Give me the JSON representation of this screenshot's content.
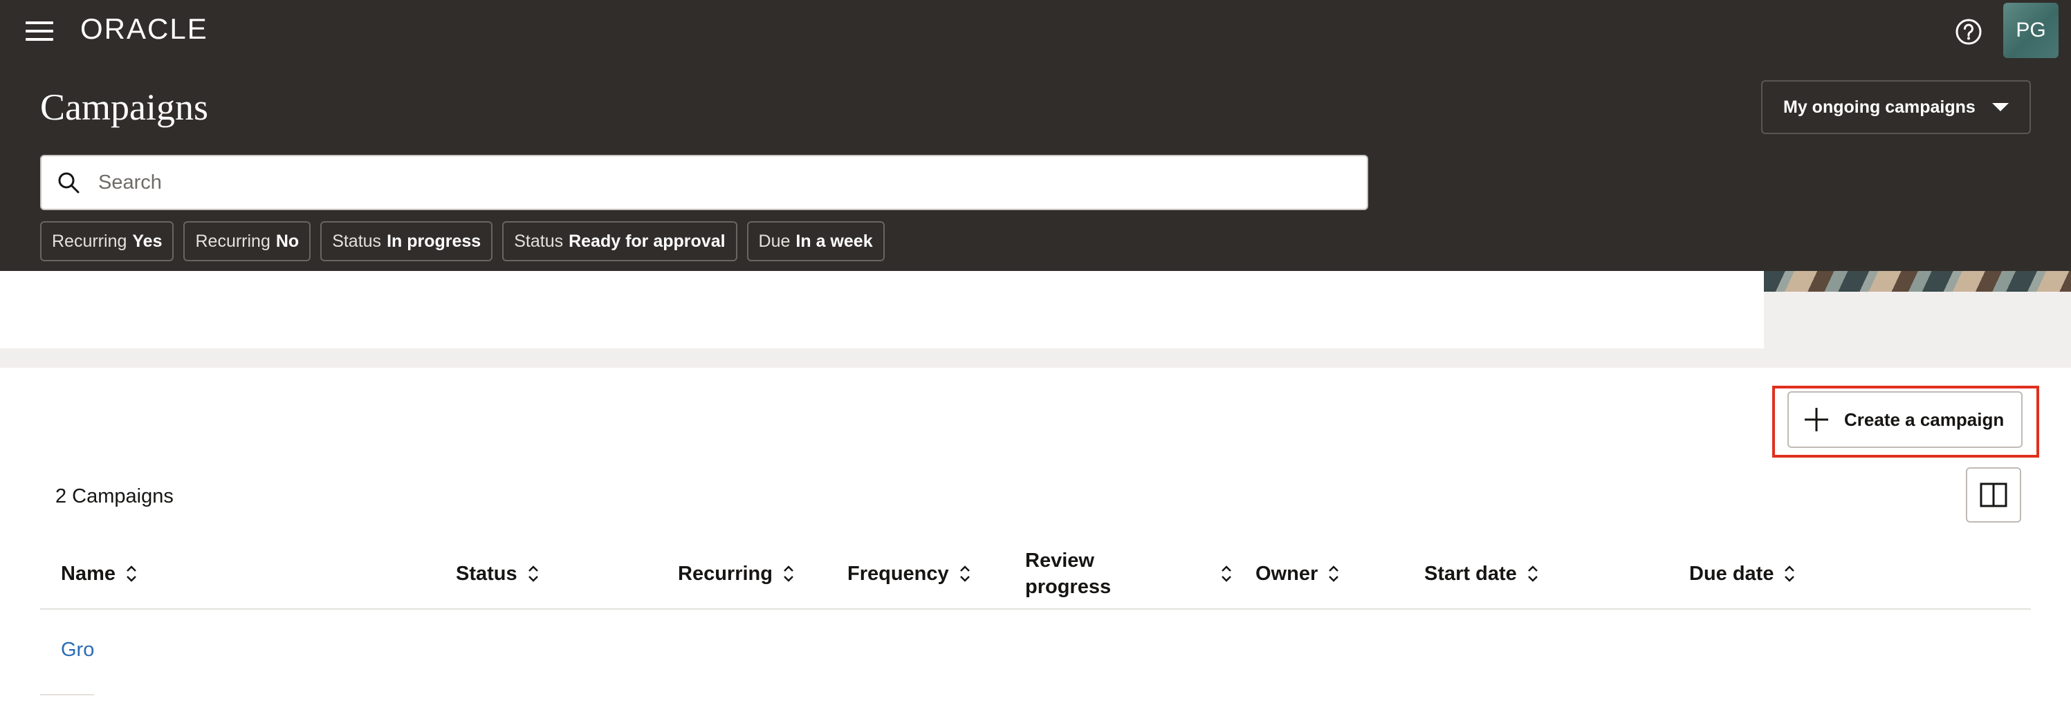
{
  "header": {
    "brand": "ORACLE",
    "help_icon": "help-circle-icon",
    "avatar_initials": "PG",
    "title": "Campaigns",
    "view_select": "My ongoing campaigns",
    "search_placeholder": "Search",
    "filter_chips": [
      {
        "key": "Recurring",
        "value": "Yes"
      },
      {
        "key": "Recurring",
        "value": "No"
      },
      {
        "key": "Status",
        "value": "In progress"
      },
      {
        "key": "Status",
        "value": "Ready for approval"
      },
      {
        "key": "Due",
        "value": "In a week"
      }
    ]
  },
  "toolbar": {
    "create_label": "Create a campaign",
    "create_icon": "plus-icon",
    "columns_icon": "columns-icon"
  },
  "list": {
    "count_label": "2 Campaigns",
    "columns": [
      "Name",
      "Status",
      "Recurring",
      "Frequency",
      "Review progress",
      "Owner",
      "Start date",
      "Due date"
    ],
    "rows": [
      {
        "name": "Gro"
      }
    ]
  },
  "colors": {
    "header_bg": "#312d2a",
    "highlight": "#e0301e",
    "link": "#2b6bb5"
  }
}
